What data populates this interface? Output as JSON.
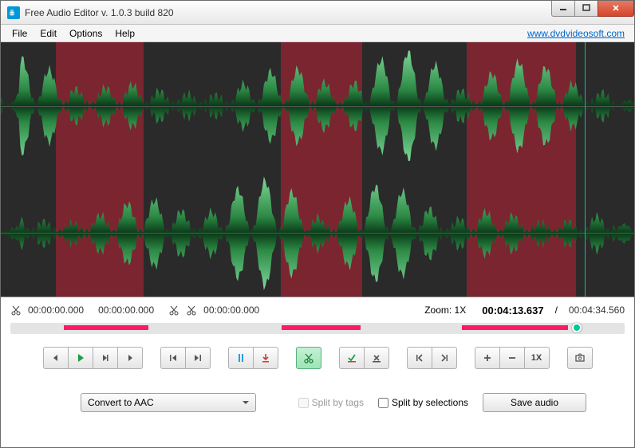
{
  "title": "Free Audio Editor v. 1.0.3 build 820",
  "menu": {
    "file": "File",
    "edit": "Edit",
    "options": "Options",
    "help": "Help",
    "link": "www.dvdvideosoft.com"
  },
  "info": {
    "sel_start": "00:00:00.000",
    "sel_end": "00:00:00.000",
    "trim_time": "00:00:00.000",
    "zoom_label": "Zoom:",
    "zoom_value": "1X",
    "current": "00:04:13.637",
    "total": "00:04:34.560"
  },
  "selections": [
    {
      "start": 8.7,
      "end": 22.5
    },
    {
      "start": 44.2,
      "end": 57.0
    },
    {
      "start": 73.5,
      "end": 90.8
    }
  ],
  "playhead_pct": 92.2,
  "toolbar": {
    "onex": "1X"
  },
  "bottom": {
    "convert": "Convert to AAC",
    "split_tags": "Split by tags",
    "split_sel": "Split by selections",
    "save": "Save audio"
  }
}
